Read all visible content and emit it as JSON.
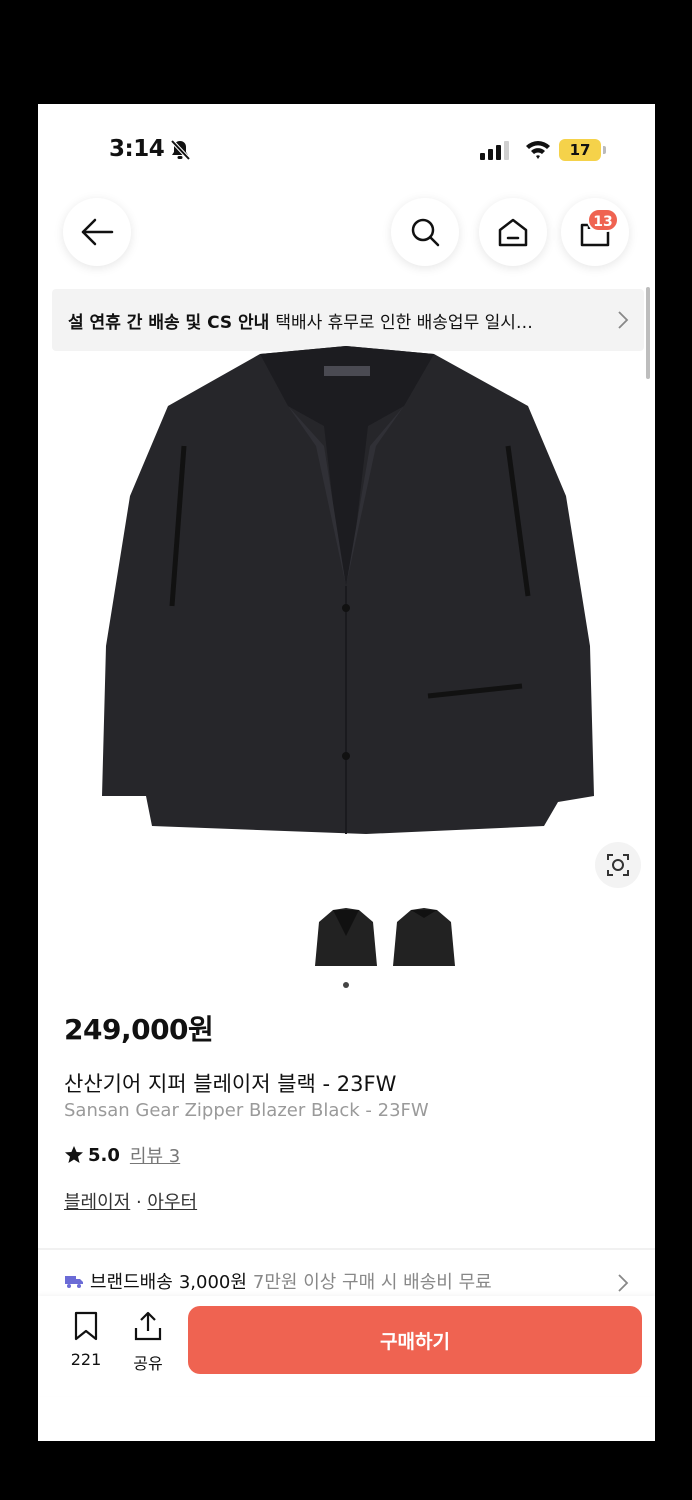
{
  "status": {
    "time": "3:14",
    "battery": "17"
  },
  "nav": {
    "cart_count": "13"
  },
  "notice": {
    "bold": "설 연휴 간 배송 및 CS 안내",
    "text": "택배사 휴무로 인한 배송업무 일시…"
  },
  "product": {
    "price": "249,000원",
    "name_ko": "산산기어 지퍼 블레이저 블랙 - 23FW",
    "name_en": "Sansan Gear Zipper Blazer Black - 23FW",
    "rating": "5.0",
    "review_label": "리뷰 3",
    "category1": "블레이저",
    "category_sep": " · ",
    "category2": "아우터"
  },
  "shipping": {
    "label": "브랜드배송",
    "fee": "3,000원",
    "note": "7만원 이상 구매 시 배송비 무료"
  },
  "bottom": {
    "bookmark_count": "221",
    "share_label": "공유",
    "buy_label": "구매하기"
  },
  "colors": {
    "accent": "#ef6351",
    "battery": "#f5d24a"
  },
  "icons": [
    "bell-slash-icon",
    "signal-icon",
    "wifi-icon",
    "back-arrow-icon",
    "search-icon",
    "home-icon",
    "cart-icon",
    "chevron-right-icon",
    "lens-icon",
    "star-icon",
    "truck-icon",
    "bookmark-icon",
    "share-icon"
  ]
}
